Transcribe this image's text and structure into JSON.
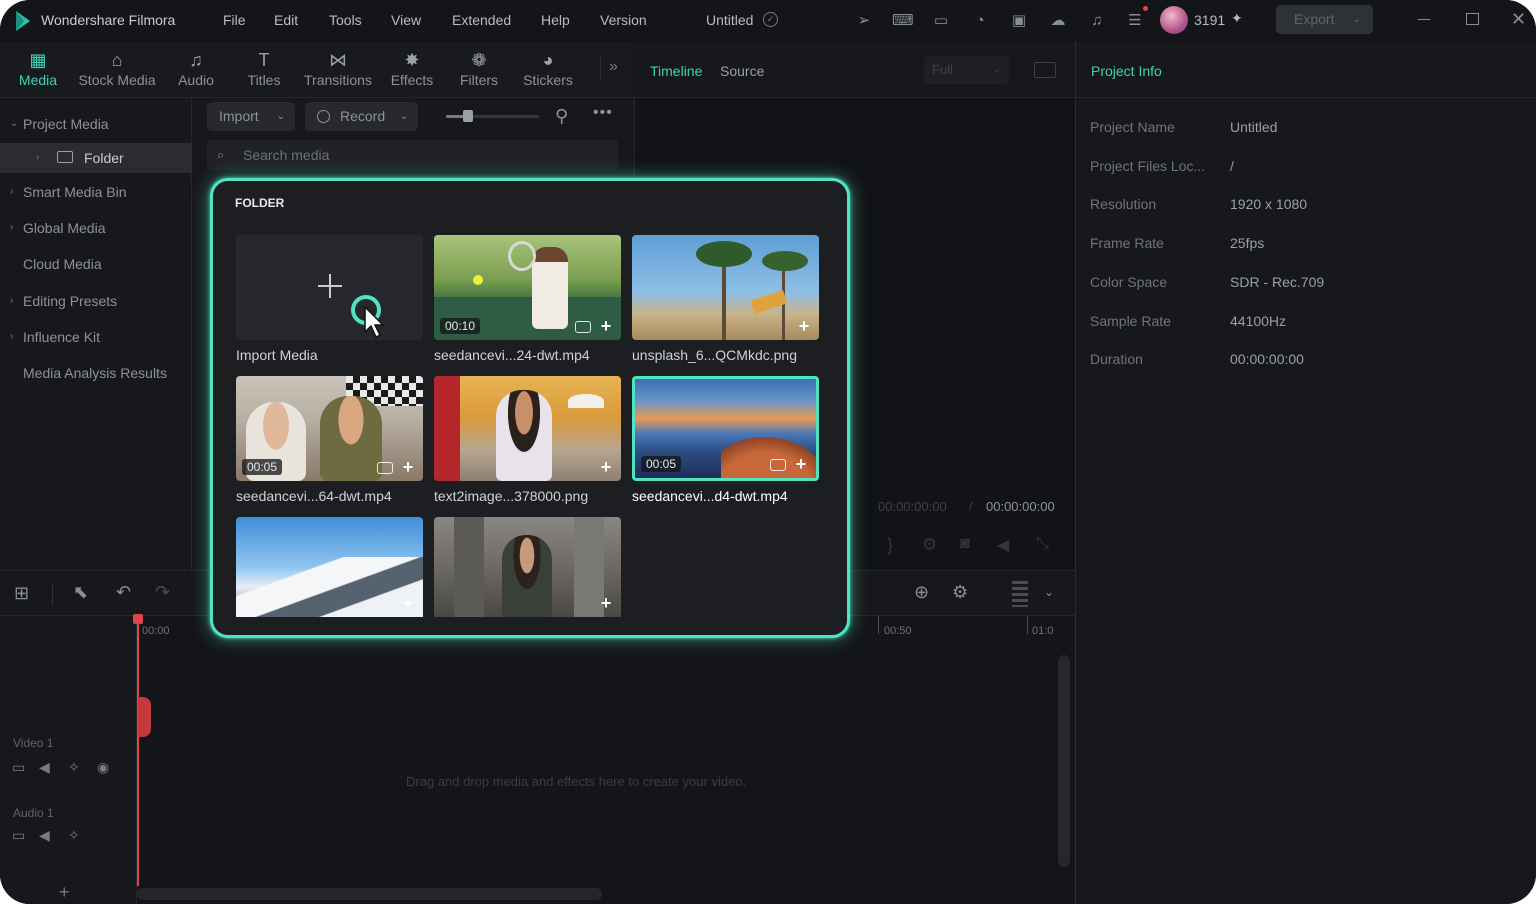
{
  "app": {
    "name": "Wondershare Filmora",
    "menu": [
      "File",
      "Edit",
      "Tools",
      "View",
      "Extended",
      "Help",
      "Version"
    ],
    "project_title": "Untitled",
    "credits": "3191",
    "export_label": "Export"
  },
  "tabs": [
    {
      "label": "Media",
      "icon": "media-icon"
    },
    {
      "label": "Stock Media",
      "icon": "stock-media-icon"
    },
    {
      "label": "Audio",
      "icon": "audio-icon"
    },
    {
      "label": "Titles",
      "icon": "titles-icon"
    },
    {
      "label": "Transitions",
      "icon": "transitions-icon"
    },
    {
      "label": "Effects",
      "icon": "effects-icon"
    },
    {
      "label": "Filters",
      "icon": "filters-icon"
    },
    {
      "label": "Stickers",
      "icon": "stickers-icon"
    }
  ],
  "sidebar": {
    "items": [
      "Project Media",
      "Folder",
      "Smart Media Bin",
      "Global Media",
      "Cloud Media",
      "Editing Presets",
      "Influence Kit",
      "Media Analysis Results"
    ]
  },
  "media_toolbar": {
    "import_label": "Import",
    "record_label": "Record",
    "search_placeholder": "Search media"
  },
  "preview": {
    "timeline_tab": "Timeline",
    "source_tab": "Source",
    "quality": "Full",
    "current_time": "00:00:00:00",
    "separator": "/",
    "total_time": "00:00:00:00"
  },
  "project_info": {
    "title": "Project Info",
    "rows": [
      {
        "label": "Project Name",
        "value": "Untitled"
      },
      {
        "label": "Project Files Loc...",
        "value": "/"
      },
      {
        "label": "Resolution",
        "value": "1920 x 1080"
      },
      {
        "label": "Frame Rate",
        "value": "25fps"
      },
      {
        "label": "Color Space",
        "value": "SDR - Rec.709"
      },
      {
        "label": "Sample Rate",
        "value": "44100Hz"
      },
      {
        "label": "Duration",
        "value": "00:00:00:00"
      }
    ]
  },
  "timeline": {
    "ruler": [
      "00:00",
      "00:50",
      "01:0"
    ],
    "video_track": "Video 1",
    "audio_track": "Audio 1",
    "empty_hint": "Drag and drop media and effects here to create your video."
  },
  "folder_popup": {
    "title": "FOLDER",
    "import_label": "Import Media",
    "items": [
      {
        "name": "seedancevi...24-dwt.mp4",
        "duration": "00:10"
      },
      {
        "name": "unsplash_6...QCMkdc.png",
        "duration": ""
      },
      {
        "name": "seedancevi...64-dwt.mp4",
        "duration": "00:05"
      },
      {
        "name": "text2image...378000.png",
        "duration": ""
      },
      {
        "name": "seedancevi...d4-dwt.mp4",
        "duration": "00:05"
      }
    ]
  },
  "colors": {
    "accent": "#3fd3b6",
    "popup_border": "#4fe3c2",
    "background": "#141518"
  }
}
